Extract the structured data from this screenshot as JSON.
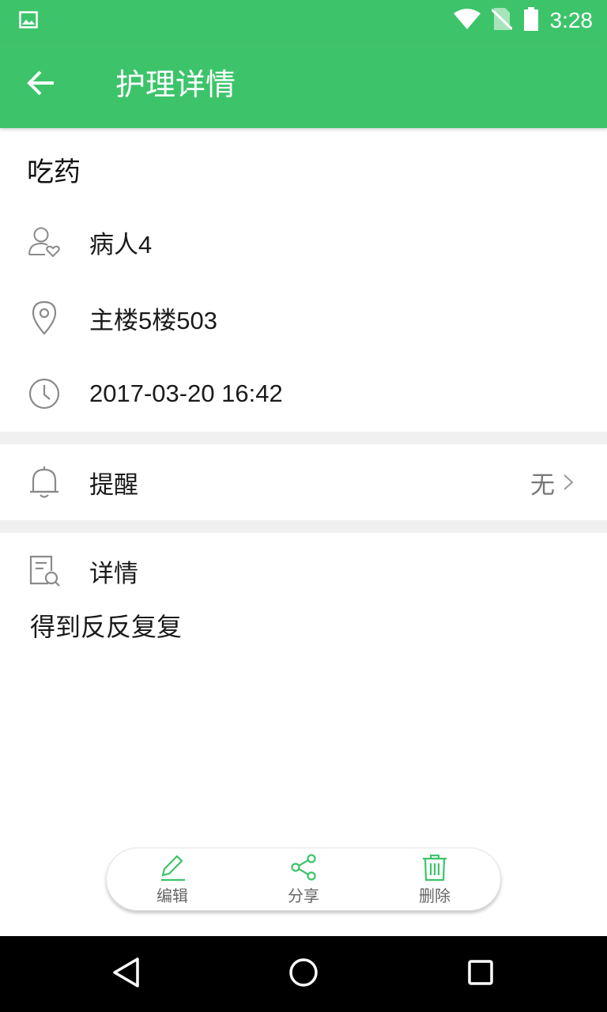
{
  "status_bar": {
    "time": "3:28",
    "icons": [
      "image-icon",
      "wifi-icon",
      "no-sim-icon",
      "battery-icon"
    ],
    "color": "#3dc46b"
  },
  "toolbar": {
    "back_icon": "arrow-back-icon",
    "title": "护理详情"
  },
  "task": {
    "title": "吃药"
  },
  "info": {
    "patient": {
      "icon": "patient-icon",
      "value": "病人4"
    },
    "location": {
      "icon": "location-pin-icon",
      "value": "主楼5楼503"
    },
    "time": {
      "icon": "clock-icon",
      "value": "2017-03-20 16:42"
    }
  },
  "reminder": {
    "icon": "bell-icon",
    "label": "提醒",
    "value": "无",
    "chevron_icon": "chevron-right-icon"
  },
  "details": {
    "icon": "document-search-icon",
    "label": "详情",
    "content": "得到反反复复"
  },
  "actions": [
    {
      "icon": "edit-icon",
      "label": "编辑"
    },
    {
      "icon": "share-icon",
      "label": "分享"
    },
    {
      "icon": "trash-icon",
      "label": "删除"
    }
  ],
  "nav": {
    "icons": [
      "back-triangle-icon",
      "home-circle-icon",
      "recents-square-icon"
    ]
  },
  "colors": {
    "accent": "#3dc46b",
    "icon_gray": "#8a8a8a",
    "divider": "#f0f0f0"
  }
}
